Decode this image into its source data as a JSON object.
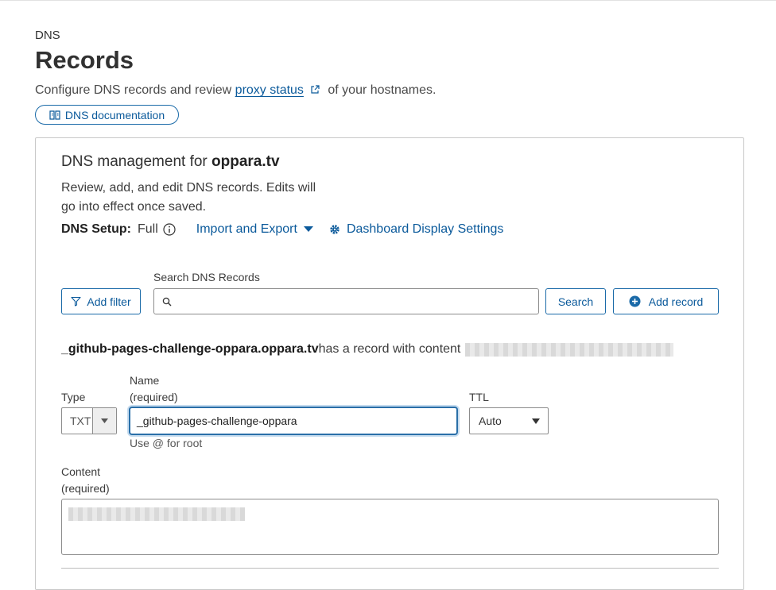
{
  "header": {
    "eyebrow": "DNS",
    "title": "Records",
    "subtitle_before": "Configure DNS records and review ",
    "subtitle_link": "proxy status",
    "subtitle_after": " of your hostnames.",
    "doc_button": "DNS documentation"
  },
  "card": {
    "title_prefix": "DNS management for ",
    "domain": "oppara.tv",
    "description": "Review, add, and edit DNS records. Edits will go into effect once saved.",
    "setup_label": "DNS Setup:",
    "setup_value": "Full",
    "import_export": "Import and Export",
    "dashboard_settings": "Dashboard Display Settings"
  },
  "search": {
    "label": "Search DNS Records",
    "placeholder": "",
    "add_filter": "Add filter",
    "search_button": "Search",
    "add_record": "Add record"
  },
  "record": {
    "hostname": "_github-pages-challenge-oppara.oppara.tv",
    "message": " has a record with content",
    "type_label": "Type",
    "type_value": "TXT",
    "name_label": "Name",
    "name_required": "(required)",
    "name_value": "_github-pages-challenge-oppara",
    "name_hint": "Use @ for root",
    "ttl_label": "TTL",
    "ttl_value": "Auto",
    "content_label": "Content",
    "content_required": "(required)"
  },
  "colors": {
    "accent": "#0b5a9b",
    "border": "#8c8c8c",
    "focus": "#2a6fa8"
  },
  "icons": [
    "external-link-icon",
    "book-icon",
    "info-icon",
    "caret-down-icon",
    "gear-icon",
    "filter-icon",
    "search-icon",
    "plus-circle-icon"
  ]
}
